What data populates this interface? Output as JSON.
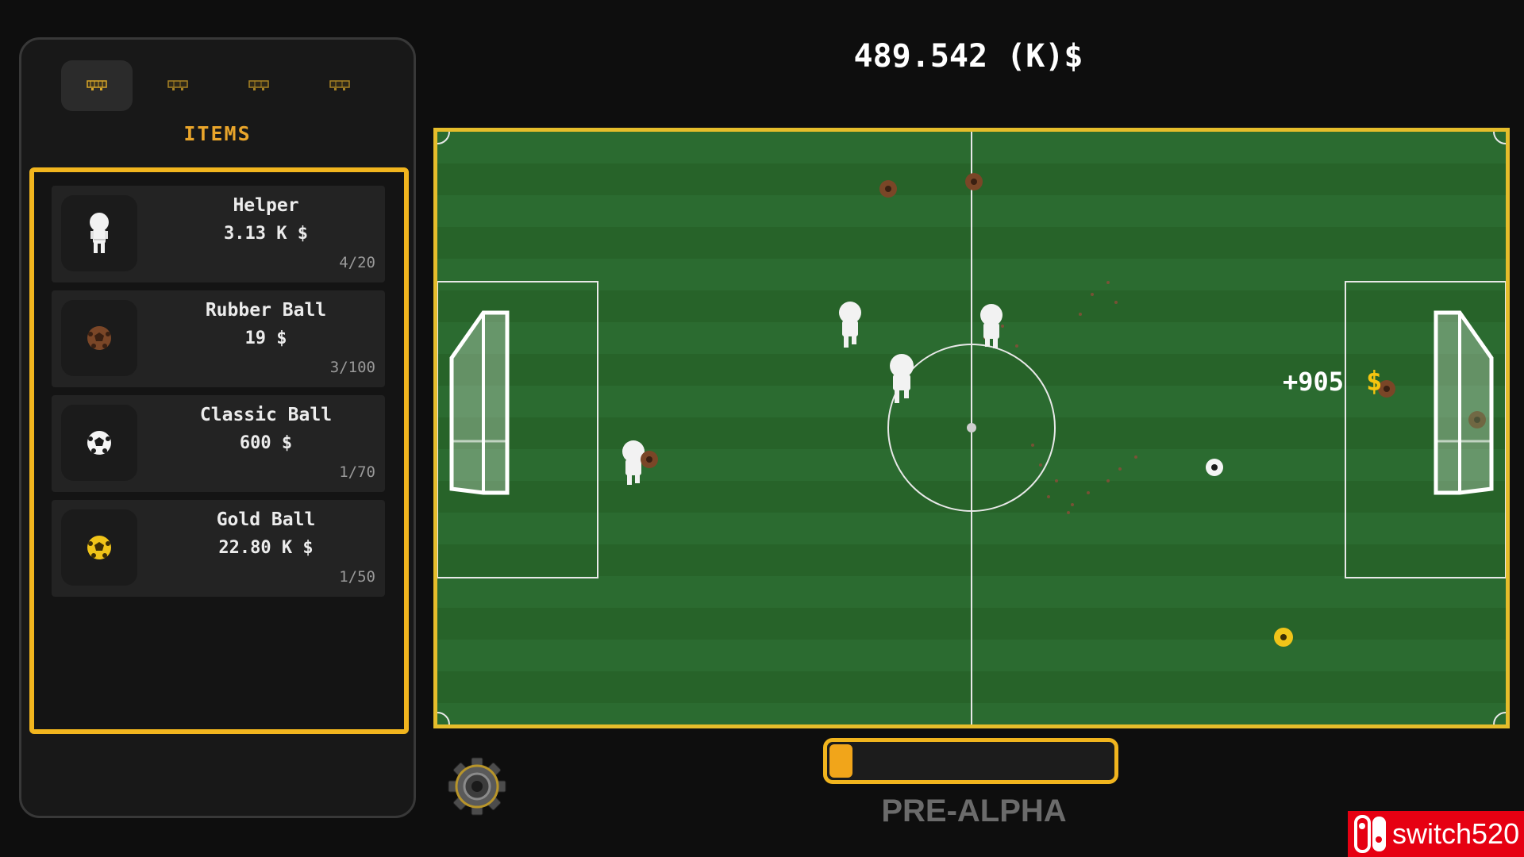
{
  "top_bar": {
    "money": "489.542 (K)$"
  },
  "shop": {
    "tabs": [
      {
        "icon": "shop-cart-icon",
        "active": true
      },
      {
        "icon": "shop-cart-icon",
        "active": false
      },
      {
        "icon": "shop-cart-icon",
        "active": false
      },
      {
        "icon": "shop-cart-icon",
        "active": false
      }
    ],
    "title": "ITEMS",
    "accent_color": "#f1b51e",
    "items": [
      {
        "name": "Helper",
        "price": "3.13 K $",
        "count": "4/20",
        "icon": "helper-icon"
      },
      {
        "name": "Rubber Ball",
        "price": "19 $",
        "count": "3/100",
        "icon": "rubber-ball-icon"
      },
      {
        "name": "Classic Ball",
        "price": "600 $",
        "count": "1/70",
        "icon": "classic-ball-icon"
      },
      {
        "name": "Gold Ball",
        "price": "22.80 K $",
        "count": "1/50",
        "icon": "gold-ball-icon"
      }
    ]
  },
  "field": {
    "grass_color": "#2a6a2f",
    "border_color": "#e5bd2b",
    "floating_reward": "+905",
    "floating_reward_icon": "dollar-icon"
  },
  "bottom": {
    "settings_icon": "gear-icon",
    "progress": 0.08,
    "build_label": "PRE-ALPHA"
  },
  "watermark": {
    "text": "switch520",
    "icon": "switch-logo-icon",
    "color": "#e60012"
  }
}
